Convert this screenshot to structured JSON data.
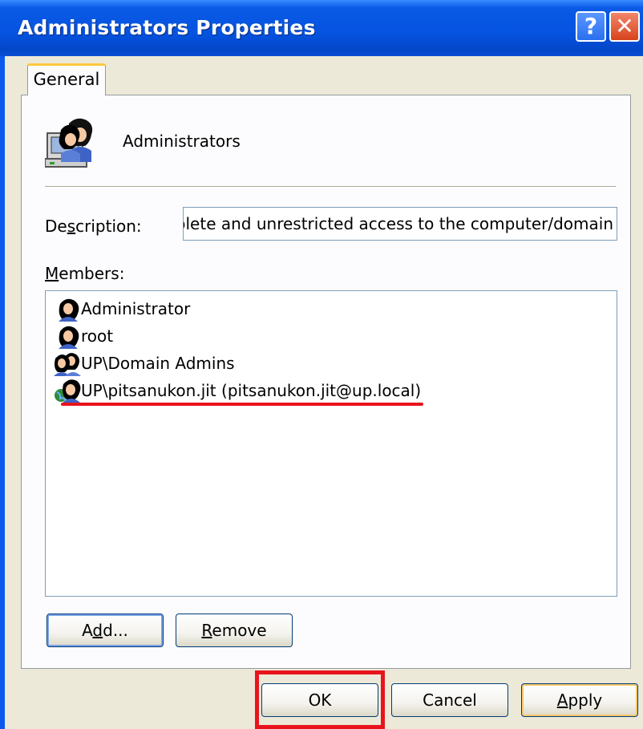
{
  "window": {
    "title": "Administrators Properties",
    "help_label": "?",
    "close_label": "✕"
  },
  "tabs": [
    {
      "label": "General",
      "selected": true
    }
  ],
  "group": {
    "icon": "group-icon",
    "name": "Administrators"
  },
  "description": {
    "label_prefix": "De",
    "label_accel": "s",
    "label_suffix": "cription:",
    "value": "Administrators have complete and unrestricted access to the computer/domain"
  },
  "members": {
    "label_accel": "M",
    "label_suffix": "embers:",
    "items": [
      {
        "icon": "user-icon",
        "name": "Administrator"
      },
      {
        "icon": "user-icon",
        "name": "root"
      },
      {
        "icon": "group-icon",
        "name": "UP\\Domain Admins"
      },
      {
        "icon": "domain-user-icon",
        "name": "UP\\pitsanukon.jit (pitsanukon.jit@up.local)"
      }
    ]
  },
  "buttons": {
    "add_prefix": "A",
    "add_accel": "d",
    "add_suffix": "d...",
    "remove_accel": "R",
    "remove_suffix": "emove",
    "ok": "OK",
    "cancel": "Cancel",
    "apply_accel": "A",
    "apply_suffix": "pply"
  },
  "annotations": {
    "highlight_color": "#e8141c"
  },
  "colors": {
    "titlebar": "#0553e0",
    "dialog_bg": "#ece9d8",
    "panel_bg": "#fcfcfe"
  }
}
